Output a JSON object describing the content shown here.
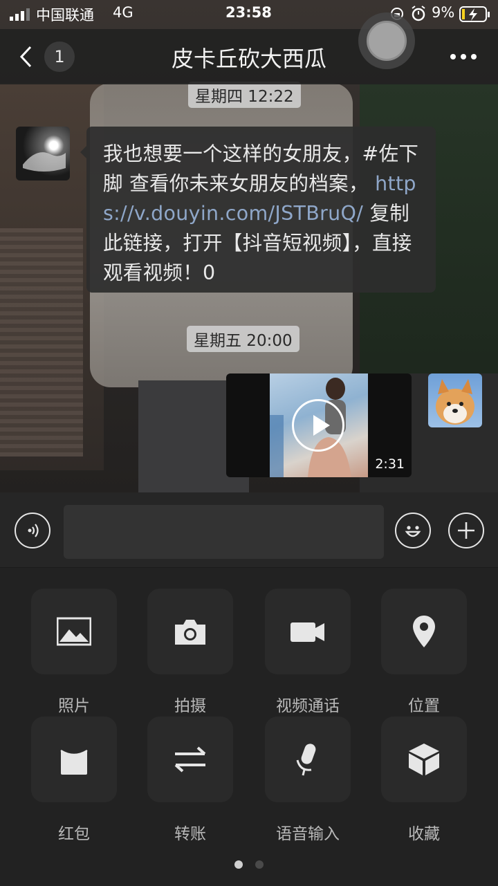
{
  "status_bar": {
    "carrier": "中国联通",
    "network": "4G",
    "time": "23:58",
    "battery_percent": "9%"
  },
  "nav": {
    "unread_count": "1",
    "title": "皮卡丘砍大西瓜"
  },
  "messages": {
    "timestamp_1": "星期四 12:22",
    "text_before_link": "我也想要一个这样的女朋友，#佐下脚 查看你未来女朋友的档案， ",
    "link": "https://v.douyin.com/JSTBruQ/",
    "text_after_link": " 复制此链接，打开【抖音短视频】，直接观看视频！0",
    "timestamp_2": "星期五 20:00",
    "video_duration": "2:31"
  },
  "input_bar": {
    "message_value": ""
  },
  "more_panel": {
    "items": [
      {
        "label": "照片",
        "icon": "photo-icon"
      },
      {
        "label": "拍摄",
        "icon": "camera-icon"
      },
      {
        "label": "视频通话",
        "icon": "video-call-icon"
      },
      {
        "label": "位置",
        "icon": "location-icon"
      },
      {
        "label": "红包",
        "icon": "red-packet-icon"
      },
      {
        "label": "转账",
        "icon": "transfer-icon"
      },
      {
        "label": "语音输入",
        "icon": "microphone-icon"
      },
      {
        "label": "收藏",
        "icon": "favorites-cube-icon"
      }
    ],
    "current_page": 1,
    "total_pages": 2
  },
  "colors": {
    "panel_bg": "#222222",
    "input_bar_bg": "#262626",
    "bubble_bg": "#2d2d2d",
    "link": "#8fa7c9",
    "label": "#b9b9b9"
  }
}
